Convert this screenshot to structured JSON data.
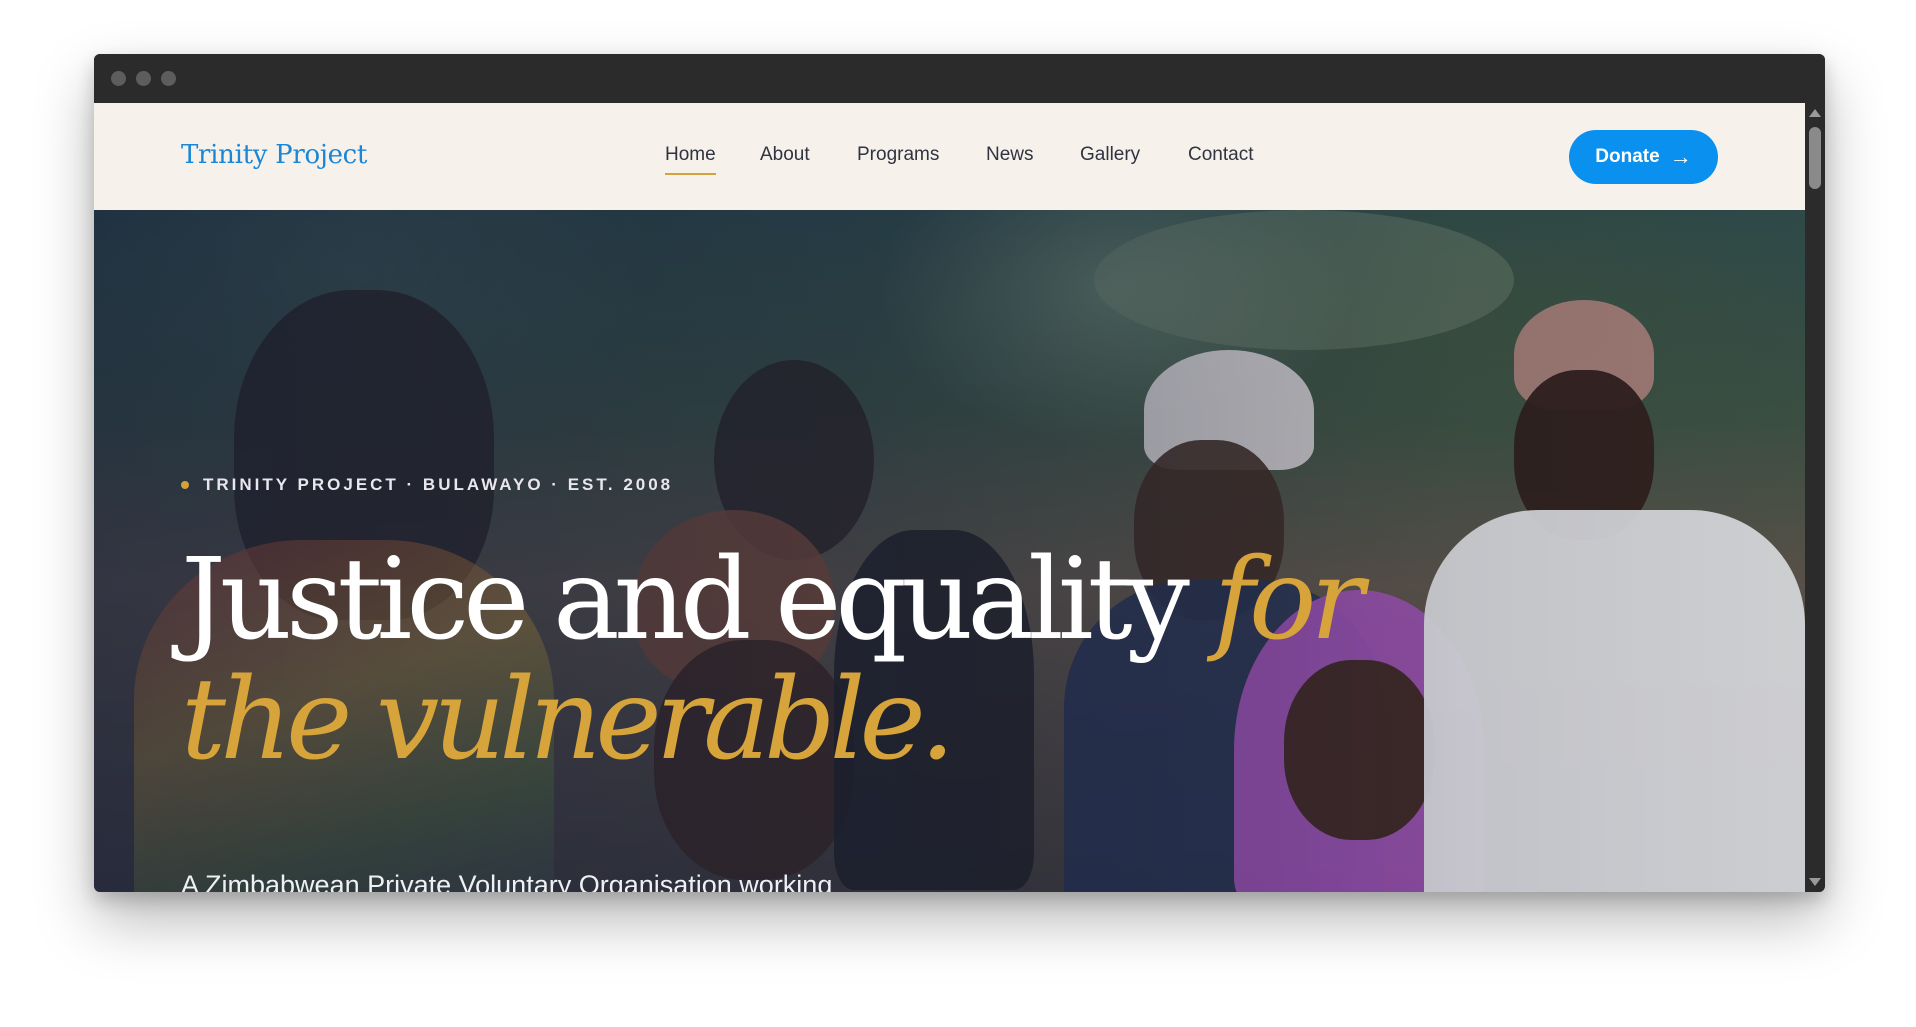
{
  "header": {
    "logo": "Trinity Project",
    "nav": [
      {
        "label": "Home",
        "active": true
      },
      {
        "label": "About",
        "active": false
      },
      {
        "label": "Programs",
        "active": false
      },
      {
        "label": "News",
        "active": false
      },
      {
        "label": "Gallery",
        "active": false
      },
      {
        "label": "Contact",
        "active": false
      }
    ],
    "donate_label": "Donate",
    "donate_icon": "arrow-right-icon"
  },
  "hero": {
    "eyebrow": "TRINITY PROJECT · BULAWAYO · EST. 2008",
    "headline_main": "Justice and equality ",
    "headline_accent": "for the vulnerable.",
    "subtext": "A Zimbabwean Private Voluntary Organisation working"
  },
  "colors": {
    "brand_blue": "#0a90ee",
    "logo_blue": "#1a86d6",
    "accent_gold": "#d4a23a",
    "header_bg": "#f6f1ea"
  }
}
